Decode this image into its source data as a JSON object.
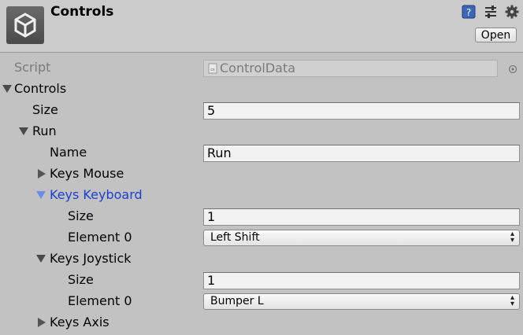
{
  "header": {
    "title": "Controls",
    "open_label": "Open",
    "icons": [
      "help-icon",
      "presets-icon",
      "gear-icon"
    ]
  },
  "script": {
    "label": "Script",
    "value": "ControlData"
  },
  "controls": {
    "label": "Controls",
    "size_label": "Size",
    "size_value": "5",
    "run": {
      "label": "Run",
      "name_label": "Name",
      "name_value": "Run",
      "keys_mouse_label": "Keys Mouse",
      "keys_keyboard": {
        "label": "Keys Keyboard",
        "size_label": "Size",
        "size_value": "1",
        "element_label": "Element 0",
        "element_value": "Left Shift"
      },
      "keys_joystick": {
        "label": "Keys Joystick",
        "size_label": "Size",
        "size_value": "1",
        "element_label": "Element 0",
        "element_value": "Bumper L"
      },
      "keys_axis_label": "Keys Axis"
    }
  },
  "colors": {
    "selected_label": "#1a3fd4",
    "background": "#c2c2c2"
  }
}
